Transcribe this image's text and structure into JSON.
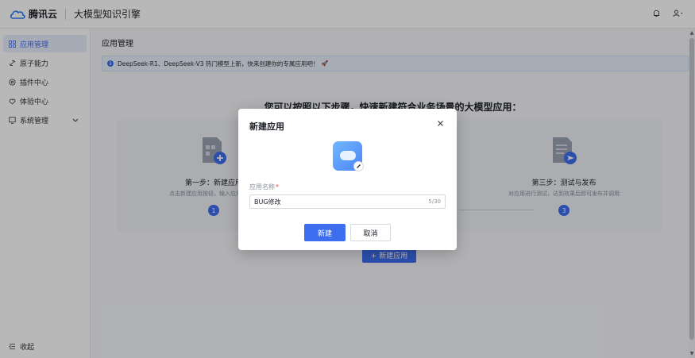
{
  "header": {
    "brand": "腾讯云",
    "product": "大模型知识引擎",
    "icons": [
      "bell-icon",
      "user-icon"
    ]
  },
  "sidebar": {
    "items": [
      {
        "label": "应用管理",
        "icon": "grid-icon",
        "active": true
      },
      {
        "label": "原子能力",
        "icon": "link-icon",
        "active": false
      },
      {
        "label": "插件中心",
        "icon": "plugin-icon",
        "active": false
      },
      {
        "label": "体验中心",
        "icon": "experience-icon",
        "active": false
      },
      {
        "label": "系统管理",
        "icon": "system-icon",
        "active": false
      }
    ],
    "collapse_label": "收起"
  },
  "main": {
    "page_title": "应用管理",
    "notice": "DeepSeek-R1、DeepSeek-V3 热门模型上新，快来创建你的专属应用吧！",
    "intro_title": "您可以按照以下步骤，快速新建符合业务场景的大模型应用：",
    "steps": [
      {
        "title": "第一步：新建应用",
        "desc": "点击新建应用按钮，输入应用名称、",
        "num": "1"
      },
      {
        "title": "第三步：测试与发布",
        "desc": "对应用进行测试，达到效果后即可发布并调用",
        "num": "3"
      }
    ],
    "create_button": "+ 新建应用"
  },
  "modal": {
    "title": "新建应用",
    "field_label": "应用名称",
    "field_value": "BUG修改",
    "field_count": "5/30",
    "confirm_label": "新建",
    "cancel_label": "取消"
  },
  "colors": {
    "primary": "#3e6ef0",
    "notice_bg": "#e6f0fb",
    "active_nav_bg": "#e8eefc"
  }
}
